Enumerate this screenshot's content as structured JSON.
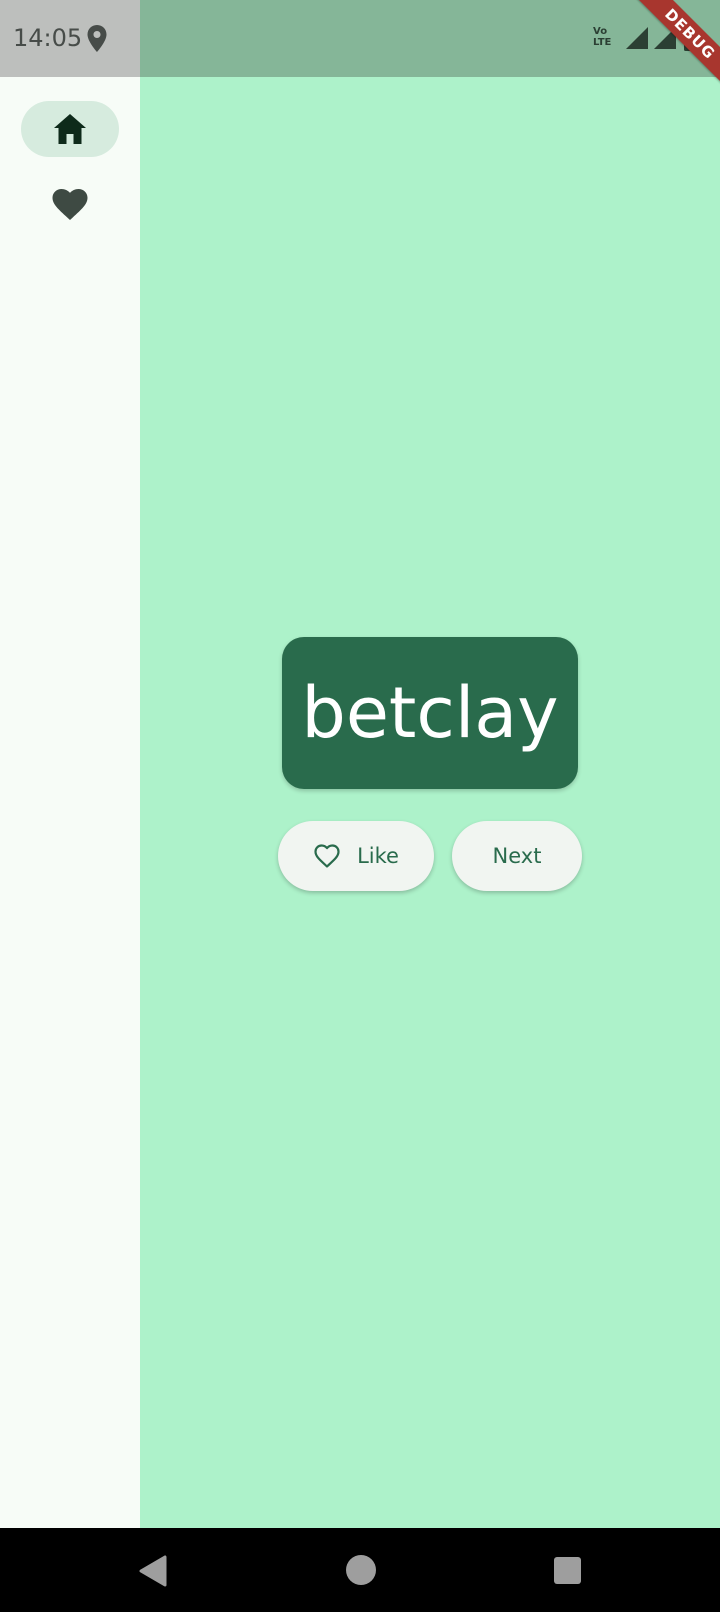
{
  "status_bar": {
    "time": "14:05",
    "volte_top": "Vo",
    "volte_bottom": "LTE",
    "icons": [
      "location-icon",
      "volte-icon",
      "signal-icon",
      "signal-icon",
      "battery-icon"
    ]
  },
  "debug_banner": {
    "label": "DEBUG",
    "color": "#A8362E"
  },
  "nav_rail": {
    "items": [
      {
        "icon": "home-icon",
        "selected": true
      },
      {
        "icon": "heart-icon",
        "selected": false
      }
    ]
  },
  "main": {
    "word": "betclay",
    "like_button": {
      "label": "Like",
      "icon": "heart-outline-icon"
    },
    "next_button": {
      "label": "Next"
    }
  },
  "colors": {
    "background": "#ADF2CA",
    "card": "#296B4C",
    "rail": "#F7FCF7",
    "rail_indicator": "#D6EBDE",
    "button_background": "#F1F5F1",
    "button_text": "#296B4C"
  },
  "system_nav": {
    "buttons": [
      "back-icon",
      "home-circle-icon",
      "recents-icon"
    ]
  }
}
